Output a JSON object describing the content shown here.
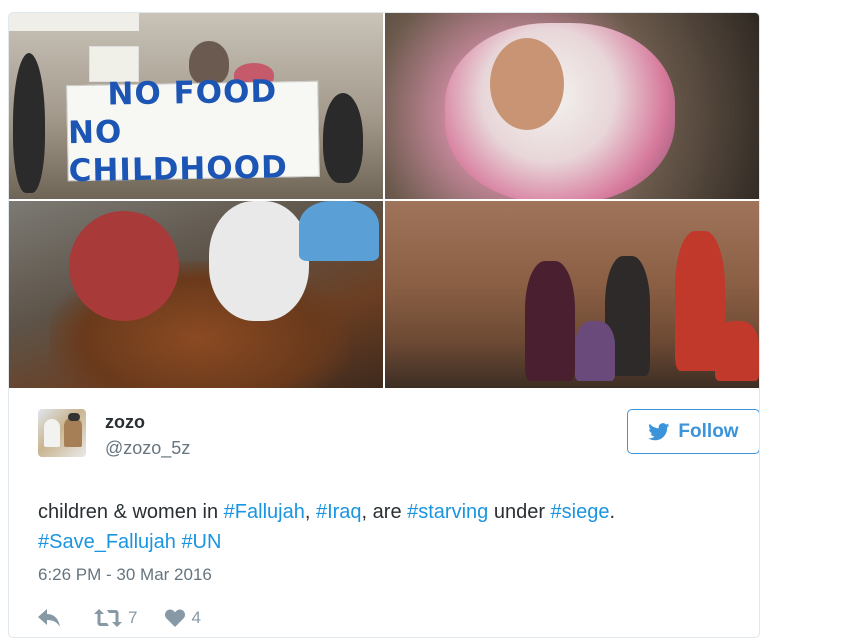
{
  "media": {
    "banner_line1": "NO FOOD",
    "banner_line2": "NO CHILDHOOD"
  },
  "user": {
    "name": "zozo",
    "handle": "@zozo_5z"
  },
  "follow_button": {
    "label": "Follow"
  },
  "tweet": {
    "text_segments": [
      {
        "t": "children & women in ",
        "tag": false
      },
      {
        "t": "#Fallujah",
        "tag": true
      },
      {
        "t": ", ",
        "tag": false
      },
      {
        "t": "#Iraq",
        "tag": true
      },
      {
        "t": ", are ",
        "tag": false
      },
      {
        "t": "#starving",
        "tag": true
      },
      {
        "t": " under ",
        "tag": false
      },
      {
        "t": "#siege",
        "tag": true
      },
      {
        "t": ".",
        "tag": false
      },
      {
        "t": "\n",
        "tag": false
      },
      {
        "t": "#Save_Fallujah",
        "tag": true
      },
      {
        "t": " ",
        "tag": false
      },
      {
        "t": "#UN",
        "tag": true
      }
    ],
    "timestamp": "6:26 PM - 30 Mar 2016"
  },
  "actions": {
    "retweet_count": "7",
    "like_count": "4"
  },
  "colors": {
    "accent": "#3b94d9",
    "hashtag": "#1b95e0",
    "secondary_text": "#66757f",
    "icon": "#8899a6"
  },
  "icons": {
    "reply": "reply-icon",
    "retweet": "retweet-icon",
    "like": "heart-icon",
    "follow": "twitter-bird-icon"
  }
}
